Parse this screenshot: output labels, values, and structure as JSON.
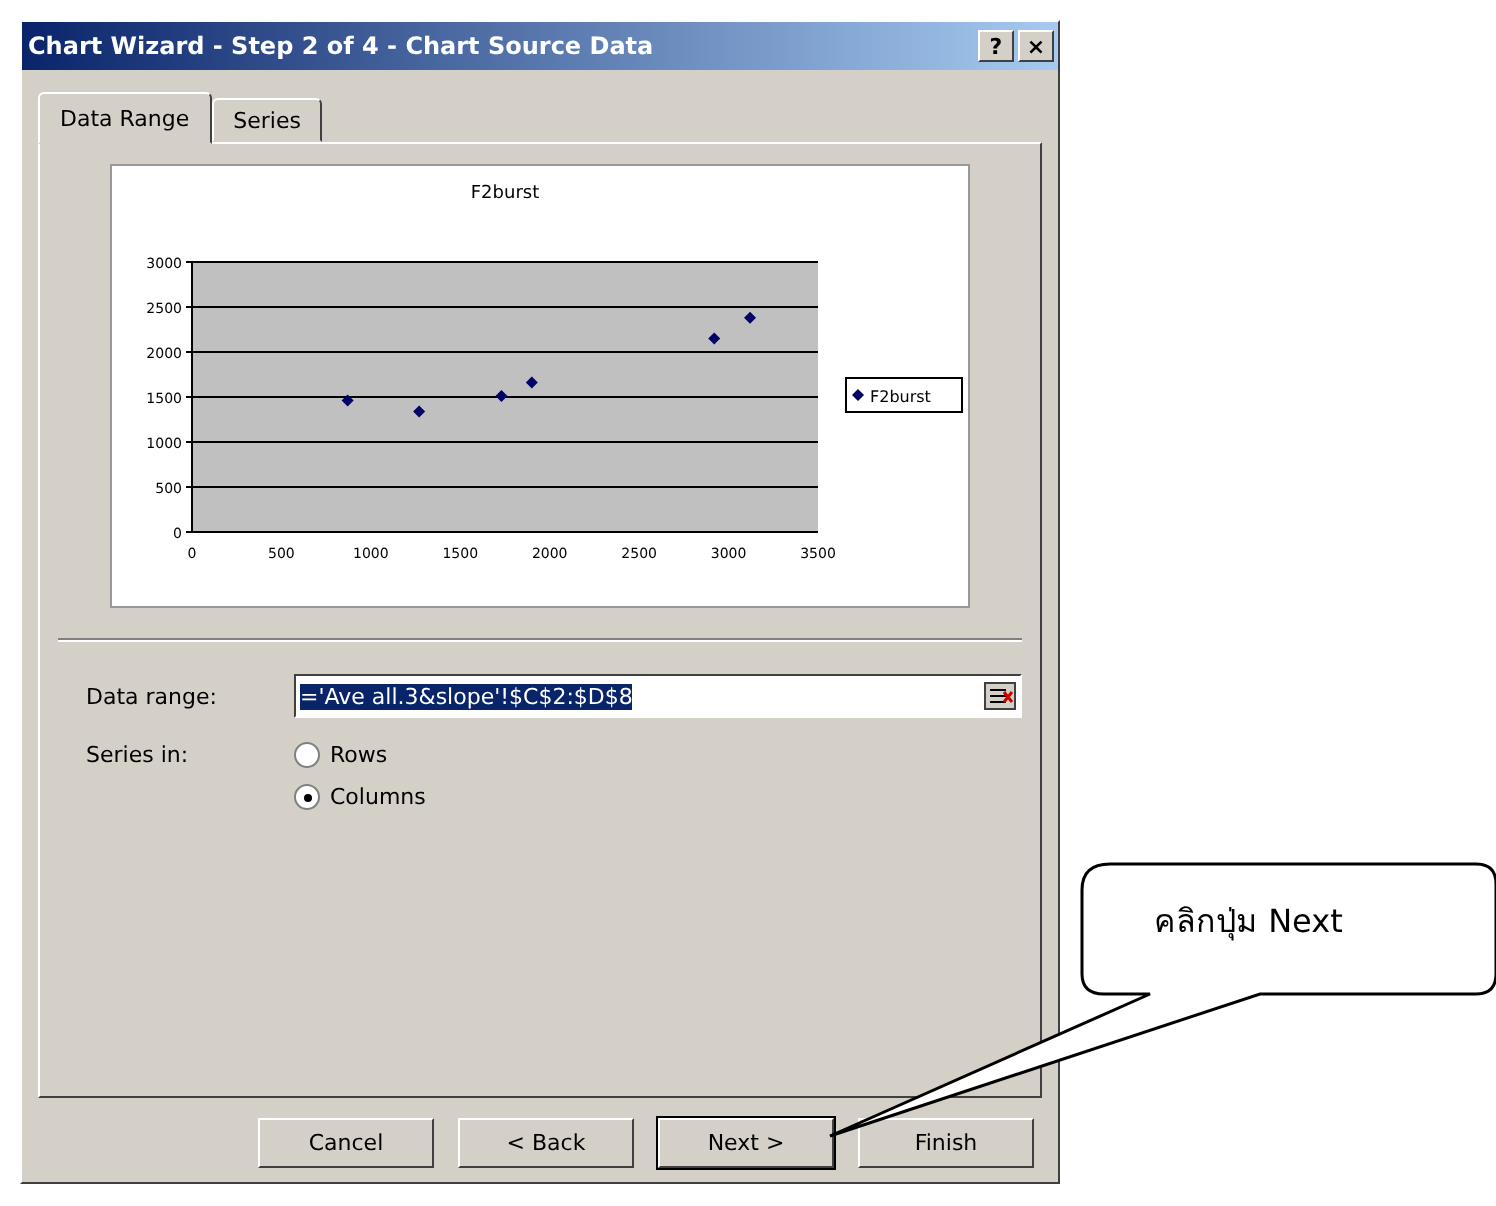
{
  "window": {
    "title": "Chart Wizard - Step 2 of 4 - Chart Source Data",
    "controls": [
      "?",
      "×"
    ]
  },
  "tabs": [
    {
      "label": "Data Range",
      "selected": true
    },
    {
      "label": "Series",
      "selected": false
    }
  ],
  "chart_data": {
    "type": "scatter",
    "title": "F2burst",
    "xlim": [
      0,
      3500
    ],
    "ylim": [
      0,
      3000
    ],
    "xticks": [
      0,
      500,
      1000,
      1500,
      2000,
      2500,
      3000,
      3500
    ],
    "yticks": [
      0,
      500,
      1000,
      1500,
      2000,
      2500,
      3000
    ],
    "grid": true,
    "x": [
      870,
      1270,
      1730,
      1900,
      2920,
      3120
    ],
    "series": [
      {
        "name": "F2burst",
        "color": "#000066",
        "values": [
          1460,
          1340,
          1510,
          1660,
          2150,
          2380
        ]
      }
    ]
  },
  "data_range": {
    "label": "Data range:",
    "value": "='Ave all.3&slope'!$C$2:$D$8"
  },
  "series_in": {
    "label": "Series in:",
    "options": [
      {
        "label": "Rows",
        "selected": false
      },
      {
        "label": "Columns",
        "selected": true
      }
    ]
  },
  "buttons": [
    {
      "label": "Cancel",
      "default": false
    },
    {
      "label": "< Back",
      "default": false
    },
    {
      "label": "Next >",
      "default": true
    },
    {
      "label": "Finish",
      "default": false
    }
  ],
  "callout": {
    "text": "คลิกปุ่ม Next"
  }
}
